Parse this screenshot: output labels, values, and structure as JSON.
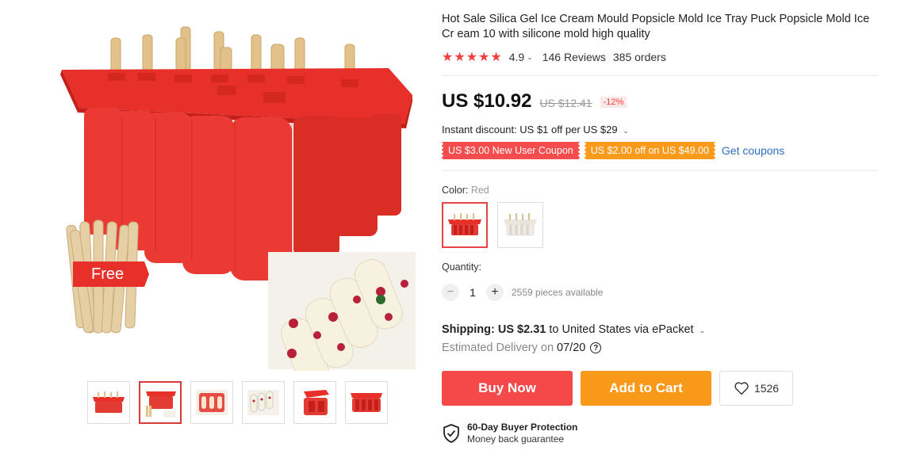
{
  "gallery": {
    "free_label": "Free",
    "thumbnails": [
      "red-mold",
      "red-mold-with-sticks",
      "red-mold-open",
      "popsicles-on-plate",
      "red-mold-angle",
      "red-mold-top"
    ]
  },
  "product": {
    "title": "Hot Sale Silica Gel Ice Cream Mould Popsicle Mold Ice Tray Puck Popsicle Mold Ice Cr eam 10 with silicone mold high quality",
    "rating": "4.9",
    "reviews": "146 Reviews",
    "orders": "385 orders",
    "price": "US $10.92",
    "old_price": "US $12.41",
    "discount": "-12%",
    "instant_discount": "Instant discount: US $1 off per US $29",
    "coupon_new_user": "US $3.00 New User Coupon",
    "coupon_off": "US $2.00 off on US $49.00",
    "get_coupons": "Get coupons",
    "color_label": "Color:",
    "color_value": "Red",
    "quantity_label": "Quantity:",
    "quantity": "1",
    "available": "2559 pieces available",
    "shipping_label": "Shipping:",
    "shipping_price": "US $2.31",
    "shipping_dest": "to United States via ePacket",
    "delivery_label": "Estimated Delivery on",
    "delivery_date": "07/20",
    "buy_now": "Buy Now",
    "add_to_cart": "Add to Cart",
    "wishlist_count": "1526",
    "protection_title": "60-Day Buyer Protection",
    "protection_sub": "Money back guarantee"
  },
  "colors": {
    "accent_red": "#f54848",
    "accent_orange": "#f8991a",
    "star": "#f43d3d",
    "link": "#2e6fc2"
  }
}
